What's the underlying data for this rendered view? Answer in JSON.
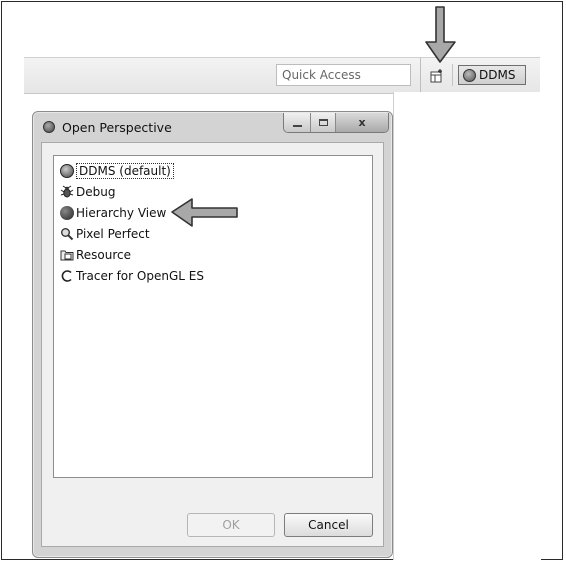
{
  "toolbar": {
    "quick_access_placeholder": "Quick Access",
    "perspective_button_label": "DDMS"
  },
  "dialog": {
    "title": "Open Perspective",
    "window_controls": {
      "minimize": "",
      "maximize": "",
      "close": "x"
    },
    "perspectives": [
      {
        "label": "DDMS (default)",
        "icon": "ddms-icon",
        "selected": true
      },
      {
        "label": "Debug",
        "icon": "debug-icon",
        "selected": false
      },
      {
        "label": "Hierarchy View",
        "icon": "hierarchy-view-icon",
        "selected": false
      },
      {
        "label": "Pixel Perfect",
        "icon": "magnifier-icon",
        "selected": false
      },
      {
        "label": "Resource",
        "icon": "resource-icon",
        "selected": false
      },
      {
        "label": "Tracer for OpenGL ES",
        "icon": "tracer-icon",
        "selected": false
      }
    ],
    "ok_label": "OK",
    "ok_enabled": false,
    "cancel_label": "Cancel"
  },
  "colors": {
    "toolbar_bg": "#e9e9e9",
    "dialog_frame": "#d3d3d3",
    "client_bg": "#f0f0f0",
    "arrow_fill": "#a8a8a8",
    "arrow_stroke": "#333333"
  }
}
